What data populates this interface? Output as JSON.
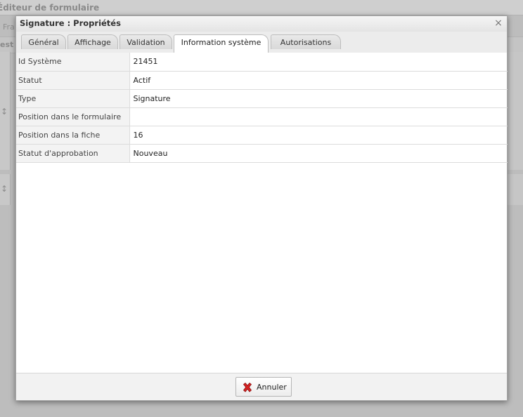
{
  "background": {
    "title": "Éditeur de formulaire",
    "toolbar_text": "Fra",
    "bar_text": "est"
  },
  "dialog": {
    "title": "Signature : Propriétés",
    "close_glyph": "×",
    "tabs": [
      {
        "label": "Général"
      },
      {
        "label": "Affichage"
      },
      {
        "label": "Validation"
      },
      {
        "label": "Information système"
      },
      {
        "label": "Autorisations"
      }
    ],
    "active_tab": "Information système",
    "properties": [
      {
        "key": "Id Système",
        "value": "21451"
      },
      {
        "key": "Statut",
        "value": "Actif"
      },
      {
        "key": "Type",
        "value": "Signature"
      },
      {
        "key": "Position dans le formulaire",
        "value": ""
      },
      {
        "key": "Position dans la fiche",
        "value": "16"
      },
      {
        "key": "Statut d'approbation",
        "value": "Nouveau"
      }
    ],
    "cancel_label": "Annuler",
    "cancel_icon": "red-x-icon"
  }
}
